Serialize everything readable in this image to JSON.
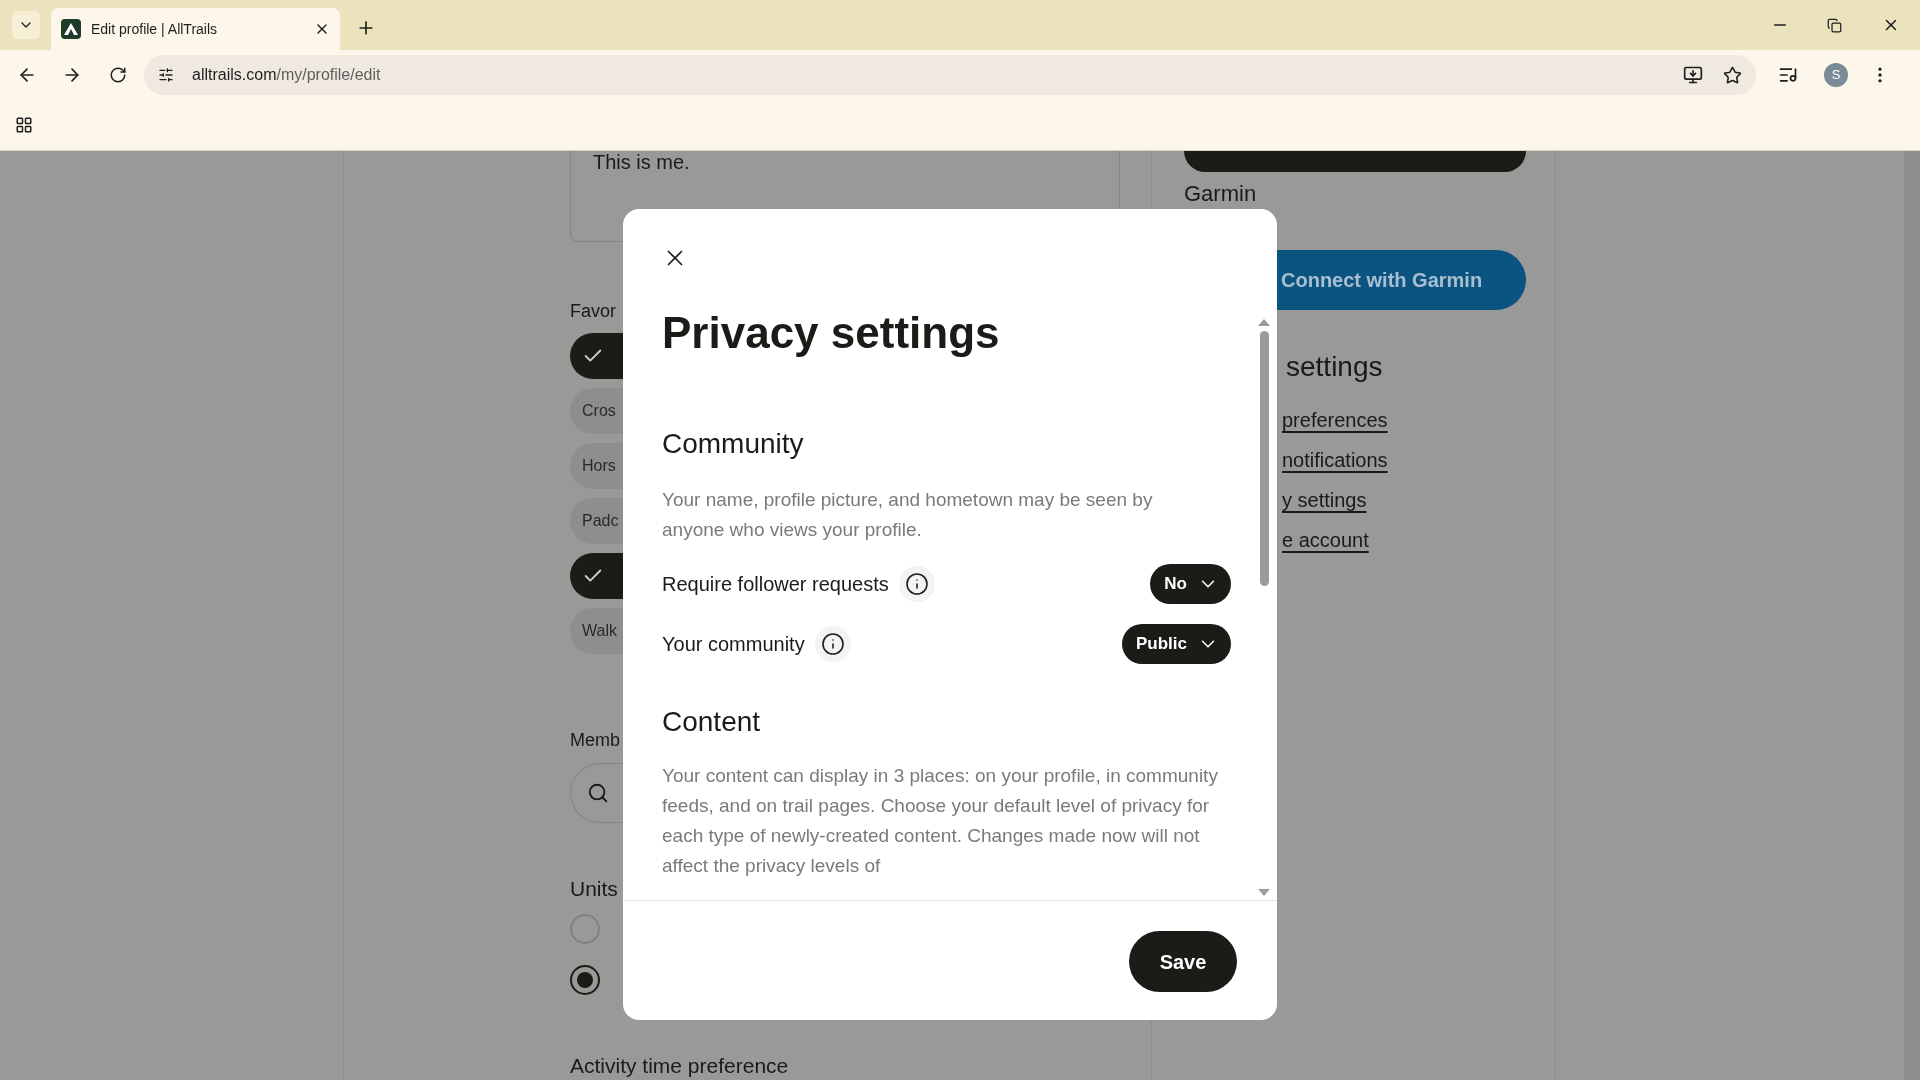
{
  "browser": {
    "tab": {
      "title": "Edit profile | AllTrails",
      "selected": true
    },
    "url": {
      "domain": "alltrails.com",
      "path": "/my/profile/edit"
    },
    "avatar": "S"
  },
  "profile_page": {
    "bio": "This is me.",
    "favorites": {
      "heading": "Favor",
      "chips": [
        {
          "selected": true
        },
        {
          "label": "Cros",
          "selected": false
        },
        {
          "label": "Hors",
          "selected": false
        },
        {
          "label": "Padc",
          "selected": false
        },
        {
          "selected": true
        },
        {
          "label": "Walk",
          "selected": false
        }
      ]
    },
    "members": {
      "heading": "Memb"
    },
    "units": {
      "heading": "Units",
      "options": [
        {
          "selected": false
        },
        {
          "selected": true
        }
      ]
    },
    "activity_heading": "Activity time preference",
    "garmin": {
      "heading": "Garmin",
      "button": "Connect with Garmin"
    },
    "settings": {
      "heading": "settings",
      "links": [
        "preferences",
        "notifications",
        "y settings",
        "e account"
      ]
    }
  },
  "modal": {
    "title": "Privacy settings",
    "sections": [
      {
        "heading": "Community",
        "description": "Your name, profile picture, and hometown may be seen by anyone who views your profile.",
        "rows": [
          {
            "label": "Require follower requests",
            "value": "No"
          },
          {
            "label": "Your community",
            "value": "Public"
          }
        ]
      },
      {
        "heading": "Content",
        "description": "Your content can display in 3 places: on your profile, in community feeds, and on trail pages. Choose your default level of privacy for each type of newly-created content. Changes made now will not affect the privacy levels of"
      }
    ],
    "save": "Save"
  }
}
